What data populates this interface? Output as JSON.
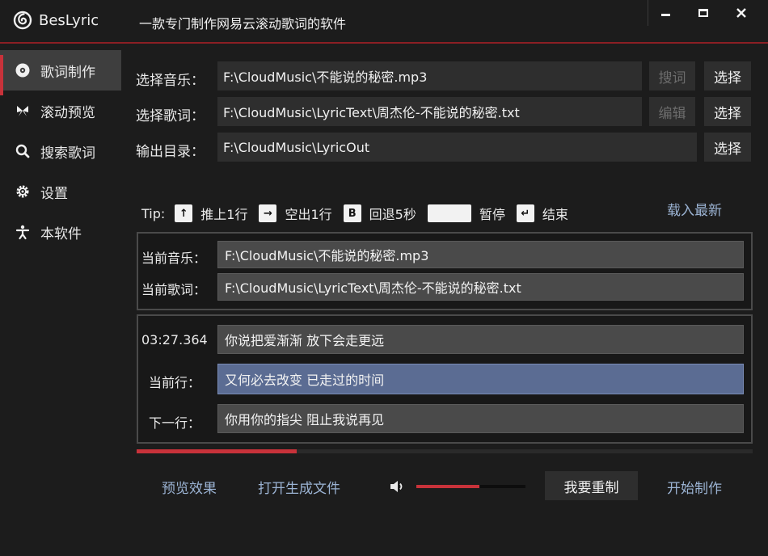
{
  "app": {
    "name": "BesLyric",
    "subtitle": "一款专门制作网易云滚动歌词的软件"
  },
  "sidebar": {
    "items": [
      {
        "label": "歌词制作",
        "icon": "disc-icon",
        "active": true
      },
      {
        "label": "滚动预览",
        "icon": "butterfly-icon",
        "active": false
      },
      {
        "label": "搜索歌词",
        "icon": "search-icon",
        "active": false
      },
      {
        "label": "设置",
        "icon": "gear-icon",
        "active": false
      },
      {
        "label": "本软件",
        "icon": "info-person-icon",
        "active": false
      }
    ]
  },
  "files": {
    "music_label": "选择音乐：",
    "music_path": "F:\\CloudMusic\\不能说的秘密.mp3",
    "search_lyric_btn": "搜词",
    "select_btn": "选择",
    "lyric_label": "选择歌词：",
    "lyric_path": "F:\\CloudMusic\\LyricText\\周杰伦-不能说的秘密.txt",
    "edit_btn": "编辑",
    "output_label": "输出目录：",
    "output_path": "F:\\CloudMusic\\LyricOut"
  },
  "tips": {
    "prefix": "Tip:",
    "up_key": "↑",
    "up_text": "推上1行",
    "right_key": "→",
    "right_text": "空出1行",
    "b_key": "B",
    "b_text": "回退5秒",
    "space_text": "暂停",
    "enter_key": "↵",
    "enter_text": "结束",
    "load_latest": "载入最新"
  },
  "current": {
    "music_label": "当前音乐：",
    "music_value": "F:\\CloudMusic\\不能说的秘密.mp3",
    "lyric_label": "当前歌词：",
    "lyric_value": "F:\\CloudMusic\\LyricText\\周杰伦-不能说的秘密.txt"
  },
  "lines": {
    "prev_time": "03:27.364",
    "prev_line": "你说把爱渐渐 放下会走更远",
    "current_label": "当前行：",
    "current_line": "又何必去改变 已走过的时间",
    "next_label": "下一行：",
    "next_line": "你用你的指尖 阻止我说再见"
  },
  "progress": 0.26,
  "volume": 0.58,
  "bottom": {
    "preview": "预览效果",
    "open_file": "打开生成文件",
    "reset": "我要重制",
    "start": "开始制作"
  },
  "colors": {
    "accent": "#c8323a",
    "link": "#9bb3d3",
    "current_line_bg": "#5b6c93"
  }
}
